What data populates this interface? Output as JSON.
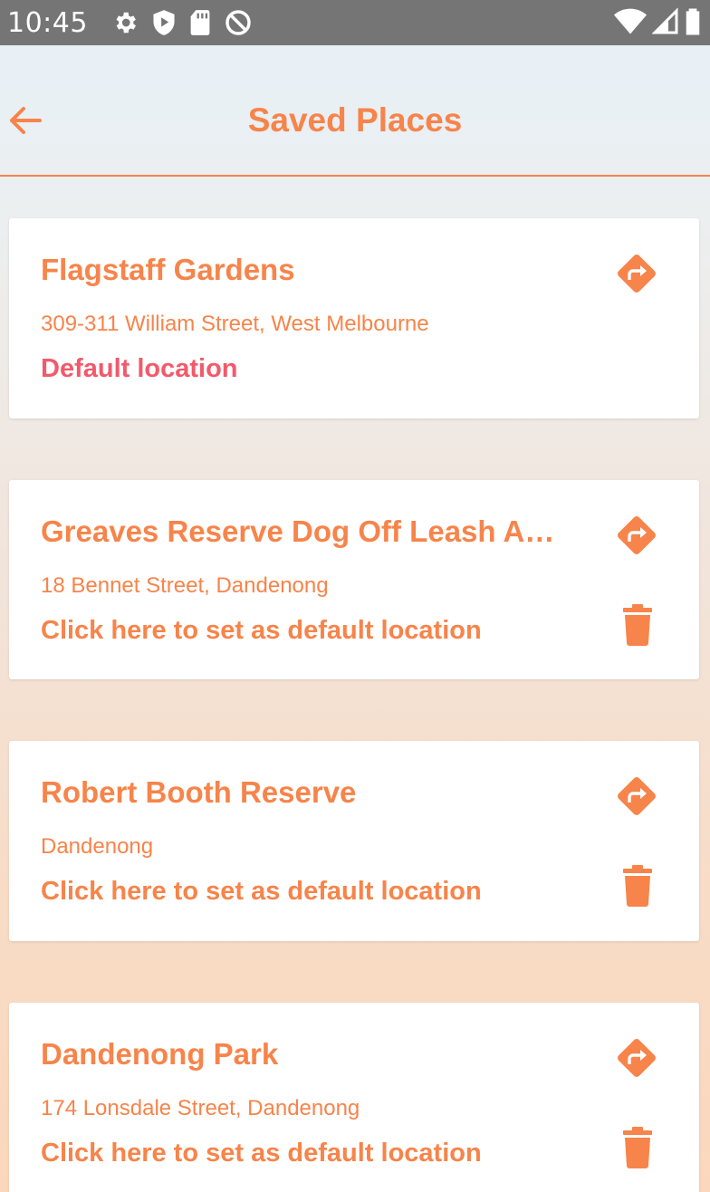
{
  "status_bar": {
    "time": "10:45"
  },
  "header": {
    "title": "Saved Places",
    "back_icon": "arrow-left-icon"
  },
  "accent_color": "#f7844a",
  "default_color": "#f25a6b",
  "places": [
    {
      "name": "Flagstaff Gardens",
      "address": "309-311 William Street, West Melbourne",
      "status": "Default location",
      "is_default": true
    },
    {
      "name": "Greaves Reserve Dog Off Leash A…",
      "address": "18 Bennet Street, Dandenong",
      "status": "Click here to set as default location",
      "is_default": false
    },
    {
      "name": "Robert Booth Reserve",
      "address": "Dandenong",
      "status": "Click here to set as default location",
      "is_default": false
    },
    {
      "name": "Dandenong Park",
      "address": "174 Lonsdale Street, Dandenong",
      "status": "Click here to set as default location",
      "is_default": false
    }
  ]
}
